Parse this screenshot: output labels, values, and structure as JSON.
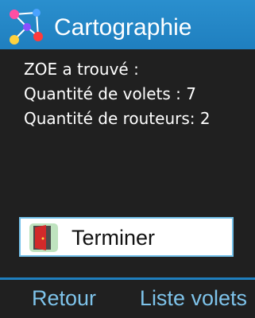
{
  "header": {
    "title": "Cartographie",
    "icon": "network-map-icon",
    "background": "#1f7fbf"
  },
  "summary": {
    "line1": "ZOE a trouvé :",
    "line2": "Quantité de volets : 7",
    "line3": "Quantité de routeurs: 2"
  },
  "finish_button": {
    "label": "Terminer",
    "icon": "exit-door-icon"
  },
  "softkeys": {
    "left": "Retour",
    "right": "Liste volets",
    "color": "#7ec3ea"
  }
}
